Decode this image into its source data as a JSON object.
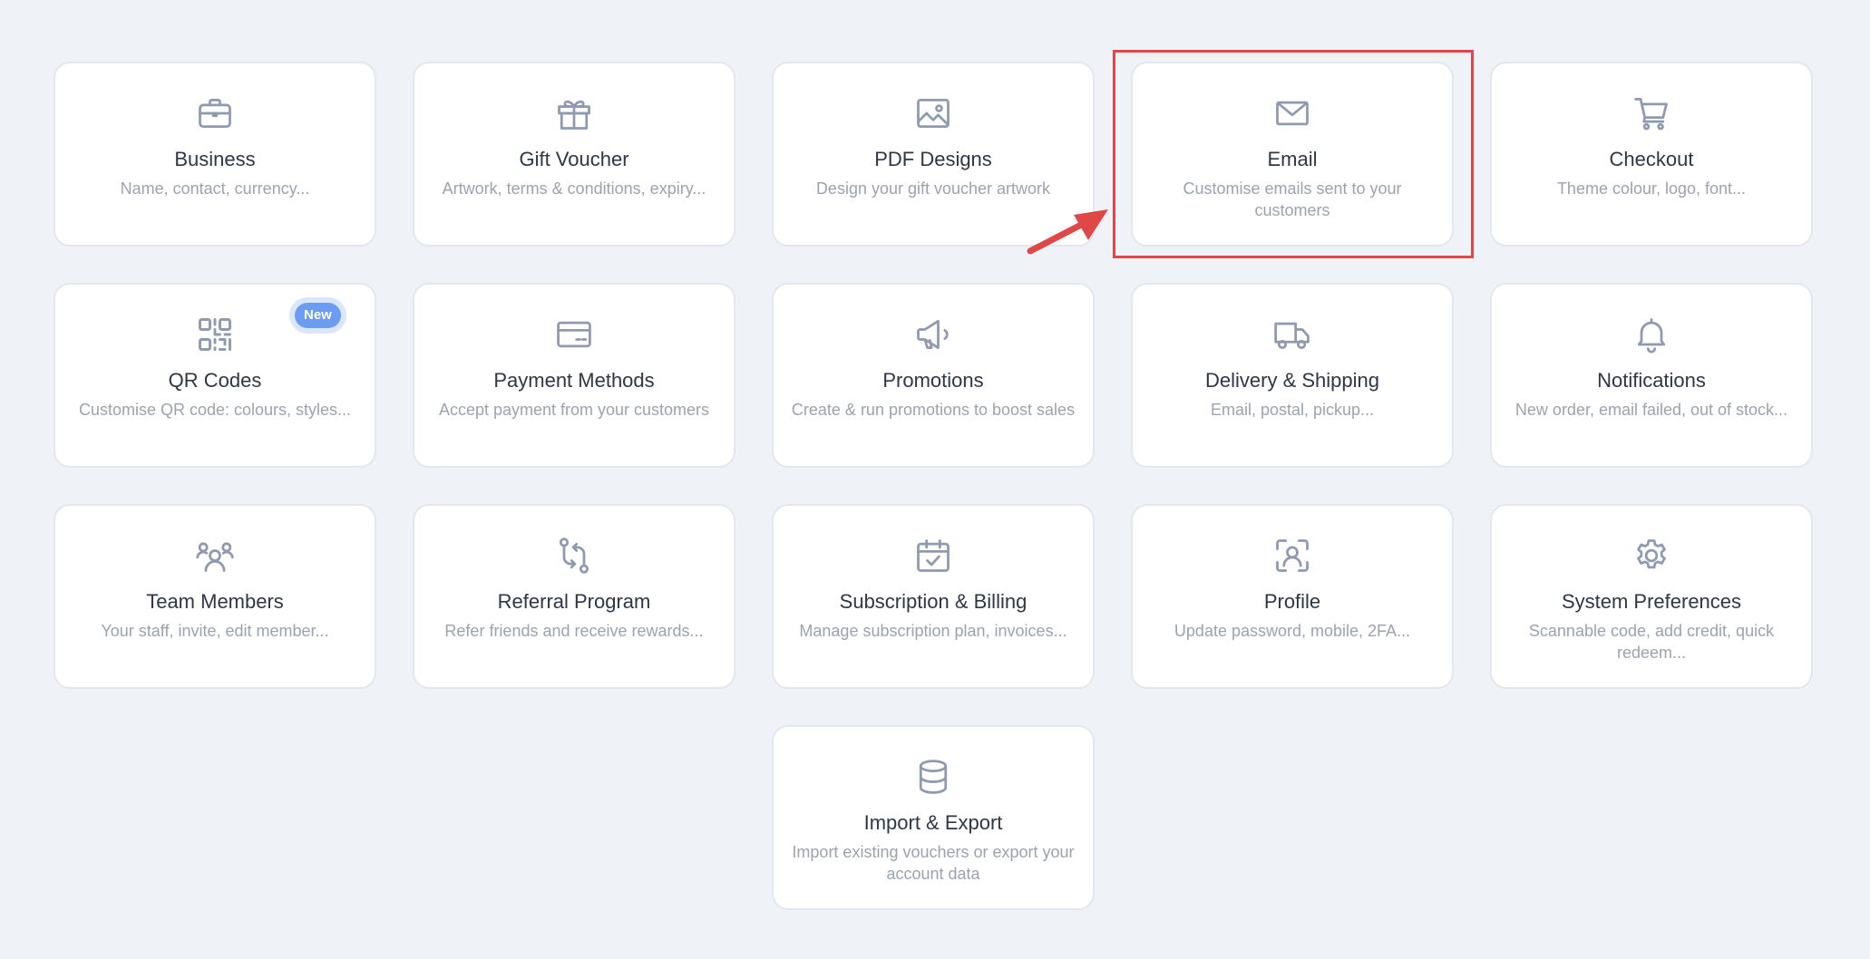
{
  "accent_colors": {
    "background": "#eff2f7",
    "card": "#ffffff",
    "title": "#2c3747",
    "description": "#9aa3b0",
    "icon": "#8e9ab0",
    "badge": "#6b9cf2",
    "highlight": "#e04848"
  },
  "cards": [
    {
      "title": "Business",
      "description": "Name, contact, currency...",
      "icon": "briefcase-icon"
    },
    {
      "title": "Gift Voucher",
      "description": "Artwork, terms & conditions, expiry...",
      "icon": "gift-icon"
    },
    {
      "title": "PDF Designs",
      "description": "Design your gift voucher artwork",
      "icon": "image-icon"
    },
    {
      "title": "Email",
      "description": "Customise emails sent to your customers",
      "icon": "envelope-icon",
      "highlighted": true
    },
    {
      "title": "Checkout",
      "description": "Theme colour, logo, font...",
      "icon": "cart-icon"
    },
    {
      "title": "QR Codes",
      "description": "Customise QR code: colours, styles...",
      "icon": "qr-code-icon",
      "badge": "New"
    },
    {
      "title": "Payment Methods",
      "description": "Accept payment from your customers",
      "icon": "credit-card-icon"
    },
    {
      "title": "Promotions",
      "description": "Create & run promotions to boost sales",
      "icon": "megaphone-icon"
    },
    {
      "title": "Delivery & Shipping",
      "description": "Email, postal, pickup...",
      "icon": "truck-icon"
    },
    {
      "title": "Notifications",
      "description": "New order, email failed, out of stock...",
      "icon": "bell-icon"
    },
    {
      "title": "Team Members",
      "description": "Your staff, invite, edit member...",
      "icon": "team-icon"
    },
    {
      "title": "Referral Program",
      "description": "Refer friends and receive rewards...",
      "icon": "referral-icon"
    },
    {
      "title": "Subscription & Billing",
      "description": "Manage subscription plan, invoices...",
      "icon": "calendar-check-icon"
    },
    {
      "title": "Profile",
      "description": "Update password, mobile, 2FA...",
      "icon": "user-scan-icon"
    },
    {
      "title": "System Preferences",
      "description": "Scannable code, add credit, quick redeem...",
      "icon": "gear-icon"
    },
    {
      "title": "Import & Export",
      "description": "Import existing vouchers or export your account data",
      "icon": "database-icon"
    }
  ]
}
